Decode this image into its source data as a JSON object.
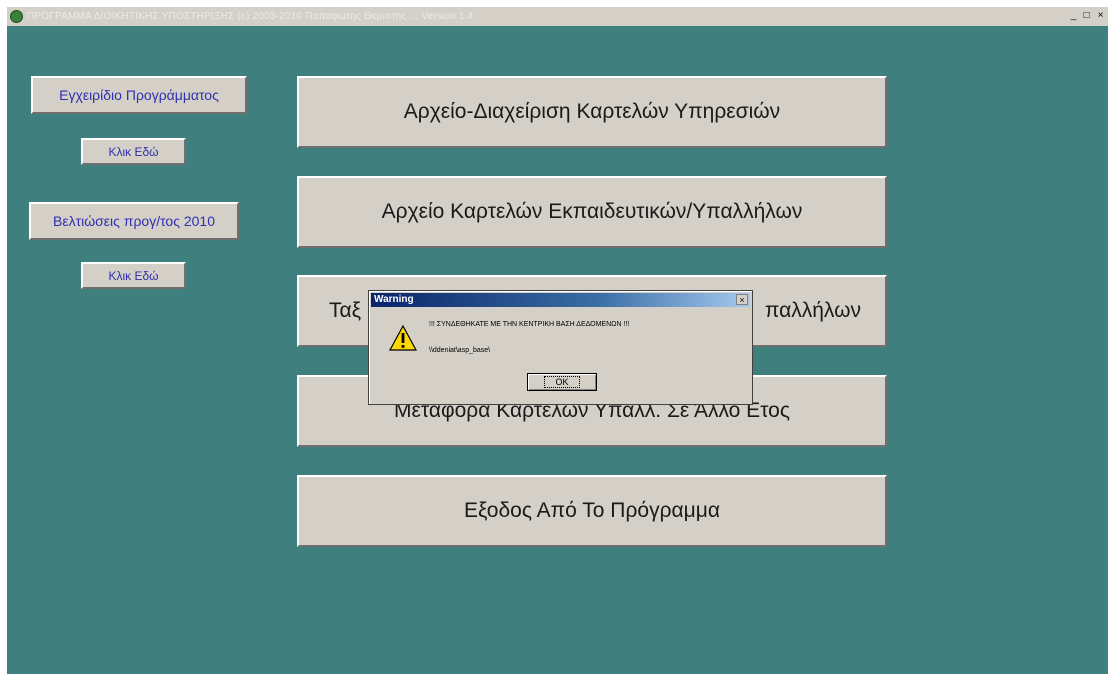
{
  "window": {
    "title": "ΠΡΟΓΡΑΜΜΑ ΔΙΟΙΚΗΤΙΚΗΣ ΥΠΟΣΤΗΡΙΞΗΣ (c) 2003-2010 Παπαφωτης Θεμιστης  ...  Version 1.4",
    "minimize": "_",
    "maximize": "□",
    "close": "×"
  },
  "sidebar": {
    "manual_label": "Εγχειρίδιο Προγράμματος",
    "manual_button": "Κλικ Εδώ",
    "improvements_label": "Βελτιώσεις προγ/τος 2010",
    "improvements_button": "Κλικ Εδώ"
  },
  "menu": {
    "btn1": "Αρχείο-Διαχείριση Καρτελών Υπηρεσιών",
    "btn2": "Αρχείο Καρτελών Εκπαιδευτικών/Υπαλλήλων",
    "btn3_left": "Ταξ",
    "btn3_right": "παλλήλων",
    "btn4": "Μεταφορά Καρτελών Υπαλλ. Σε  Άλλο Ετος",
    "btn5": "Εξοδος Από Το Πρόγραμμα"
  },
  "dialog": {
    "title": "Warning",
    "close": "×",
    "message": "!!! ΣΥΝΔΕΘΗΚΑΤΕ ΜΕ ΤΗΝ ΚΕΝΤΡΙΚΗ ΒΑΣΗ ΔΕΔΟΜΕΝΩΝ !!!",
    "path": "\\\\ddeniat\\asp_base\\",
    "ok": "OK",
    "icon": "warning-icon"
  },
  "colors": {
    "background": "#3f7f7e",
    "button_face": "#d4d0c8",
    "side_text": "#2f2faf",
    "dialog_title": "#0a246a"
  }
}
